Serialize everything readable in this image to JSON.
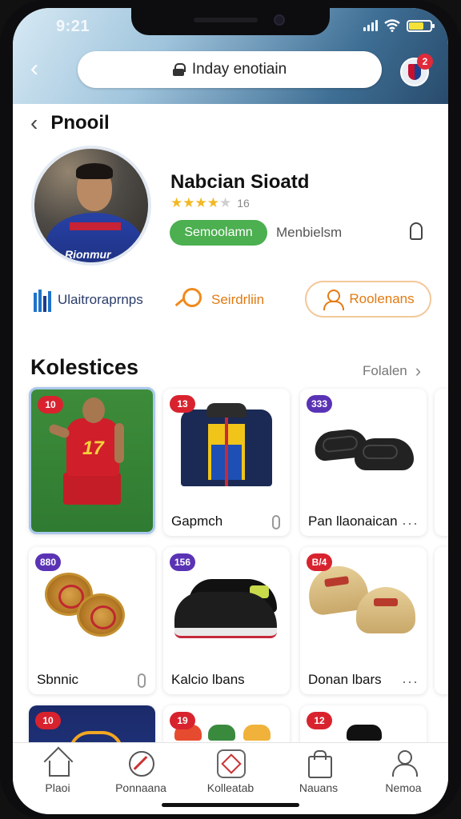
{
  "status_bar": {
    "time": "9:21"
  },
  "header": {
    "search_label": "Inday enotiain",
    "notification_count": "2"
  },
  "page": {
    "title": "Pnooil"
  },
  "profile": {
    "name": "Nabcian Sioatd",
    "rating": 4,
    "rating_max": 5,
    "rating_count": "16",
    "status_label": "Semoolamn",
    "member_label": "Menbielsm",
    "jersey_text": "Rionmur"
  },
  "actions": [
    {
      "label": "Ulaitroraprnps"
    },
    {
      "label": "Seirdrliin"
    },
    {
      "label": "Roolenans"
    }
  ],
  "collections": {
    "title": "Kolestices",
    "see_all": "Folalen",
    "items": [
      {
        "badge": "10",
        "badge_color": "#d8232f",
        "title": "",
        "art": "football-player"
      },
      {
        "badge": "13",
        "badge_color": "#d8232f",
        "title": "Gapmch",
        "art": "track-jacket"
      },
      {
        "badge": "333",
        "badge_color": "#5a33b5",
        "title": "Pan llaonaican",
        "art": "black-slides"
      },
      {
        "badge": "880",
        "badge_color": "#5a33b5",
        "title": "Sbnnic",
        "art": "ornate-sandals"
      },
      {
        "badge": "156",
        "badge_color": "#5a33b5",
        "title": "Kalcio lbans",
        "art": "black-sneakers"
      },
      {
        "badge": "B/4",
        "badge_color": "#d8232f",
        "title": "Donan lbars",
        "art": "beige-loafers"
      },
      {
        "badge": "10",
        "badge_color": "#d8232f",
        "title": "",
        "art": "blue-item"
      },
      {
        "badge": "19",
        "badge_color": "#d8232f",
        "title": "",
        "art": "colorful-shoes"
      },
      {
        "badge": "12",
        "badge_color": "#d8232f",
        "title": "",
        "art": "black-shoe"
      }
    ]
  },
  "tabbar": [
    {
      "label": "Plaoi",
      "icon": "home-icon"
    },
    {
      "label": "Ponnaana",
      "icon": "sport-icon"
    },
    {
      "label": "Kolleatab",
      "icon": "collection-icon"
    },
    {
      "label": "Nauans",
      "icon": "bag-icon"
    },
    {
      "label": "Nemoa",
      "icon": "user-icon"
    }
  ],
  "colors": {
    "accent_green": "#4caf50",
    "accent_orange": "#e47a12",
    "badge_red": "#d8232f",
    "badge_purple": "#5a33b5"
  }
}
